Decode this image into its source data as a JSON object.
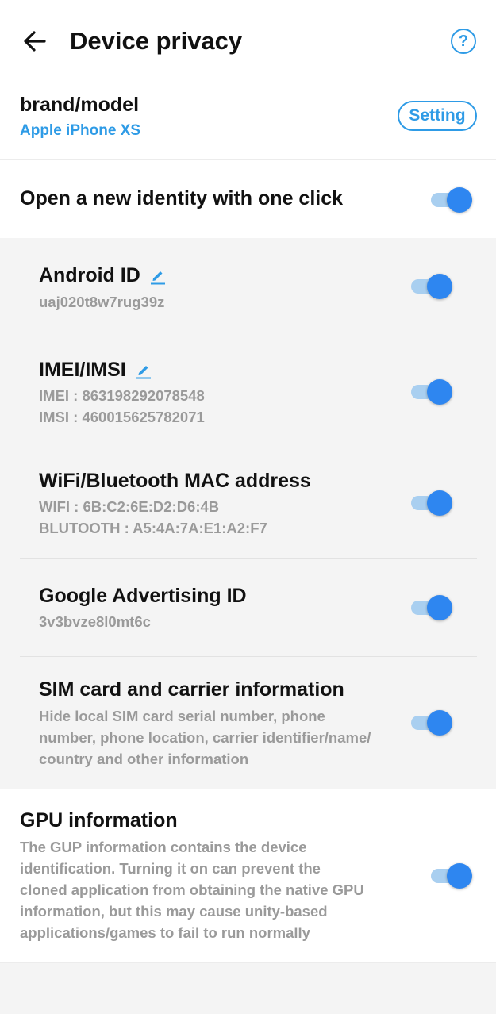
{
  "header": {
    "title": "Device privacy"
  },
  "brand": {
    "label": "brand/model",
    "value": "Apple iPhone XS",
    "setting_label": "Setting"
  },
  "new_identity": {
    "label": "Open a new identity with one click",
    "enabled": true
  },
  "items": {
    "android_id": {
      "title": "Android ID",
      "value": "uaj020t8w7rug39z",
      "enabled": true
    },
    "imei": {
      "title": "IMEI/IMSI",
      "imei": "IMEI : 863198292078548",
      "imsi": "IMSI : 460015625782071",
      "enabled": true
    },
    "mac": {
      "title": "WiFi/Bluetooth MAC address",
      "wifi": "WIFI : 6B:C2:6E:D2:D6:4B",
      "bluetooth": "BLUTOOTH : A5:4A:7A:E1:A2:F7",
      "enabled": true
    },
    "gaid": {
      "title": "Google Advertising ID",
      "value": "3v3bvze8l0mt6c",
      "enabled": true
    },
    "sim": {
      "title": "SIM card and carrier information",
      "desc_line1": "Hide local SIM card serial number, phone",
      "desc_line2": "number, phone location, carrier identifier/name/",
      "desc_line3": "country and other information",
      "enabled": true
    }
  },
  "gpu": {
    "title": "GPU information",
    "desc_line1": "The GUP information contains the device",
    "desc_line2": "identification. Turning it on can prevent the",
    "desc_line3": "cloned application from obtaining the native GPU",
    "desc_line4": "information, but this may cause unity-based",
    "desc_line5": "applications/games to fail to run normally",
    "enabled": true
  },
  "icons": {
    "back": "arrow-left-icon",
    "help": "question-circle-icon",
    "edit": "pencil-icon"
  },
  "colors": {
    "accent": "#2e9be6",
    "toggle_on": "#2e86f0",
    "toggle_track": "#a9cff0",
    "muted_text": "#9a9a9a"
  }
}
